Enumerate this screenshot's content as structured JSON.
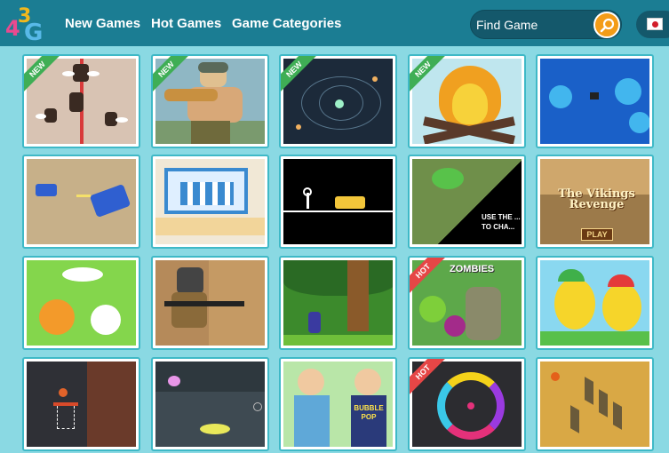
{
  "header": {
    "logo": "43G",
    "nav": [
      "New Games",
      "Hot Games",
      "Game Categories"
    ],
    "search_placeholder": "Find Game"
  },
  "badges": {
    "new": "NEW",
    "hot": "HOT"
  },
  "games": [
    {
      "badge": "new",
      "icon": "angel-birds-thumbnail"
    },
    {
      "badge": "new",
      "icon": "soldier-thumbnail"
    },
    {
      "badge": "new",
      "icon": "space-web-thumbnail"
    },
    {
      "badge": "new",
      "icon": "campfire-thumbnail"
    },
    {
      "badge": "",
      "icon": "underwater-bubbles-thumbnail"
    },
    {
      "badge": "",
      "icon": "tank-battle-thumbnail"
    },
    {
      "badge": "",
      "icon": "building-blocks-thumbnail"
    },
    {
      "badge": "",
      "icon": "taxi-stickman-thumbnail"
    },
    {
      "badge": "",
      "icon": "frog-thumbnail",
      "caption": "USE THE ... TO CHA..."
    },
    {
      "badge": "",
      "icon": "vikings-revenge-thumbnail",
      "title": "The Vikings Revenge",
      "button": "PLAY"
    },
    {
      "badge": "",
      "icon": "cute-creatures-thumbnail"
    },
    {
      "badge": "",
      "icon": "sniper-soldier-thumbnail"
    },
    {
      "badge": "",
      "icon": "jungle-platform-thumbnail"
    },
    {
      "badge": "hot",
      "icon": "plants-vs-zombies-thumbnail",
      "title": "ZOMBIES"
    },
    {
      "badge": "",
      "icon": "twin-birds-thumbnail"
    },
    {
      "badge": "",
      "icon": "basketball-thumbnail"
    },
    {
      "badge": "",
      "icon": "fishing-thumbnail"
    },
    {
      "badge": "",
      "icon": "dress-up-girls-thumbnail",
      "caption": "BUBBLE POP"
    },
    {
      "badge": "hot",
      "icon": "color-switch-thumbnail"
    },
    {
      "badge": "",
      "icon": "isometric-blocks-thumbnail"
    }
  ],
  "colors": {
    "header": "#1b7d93",
    "page": "#8ad9e3",
    "tile_border": "#3fb9c7",
    "search_button": "#f39c17"
  }
}
